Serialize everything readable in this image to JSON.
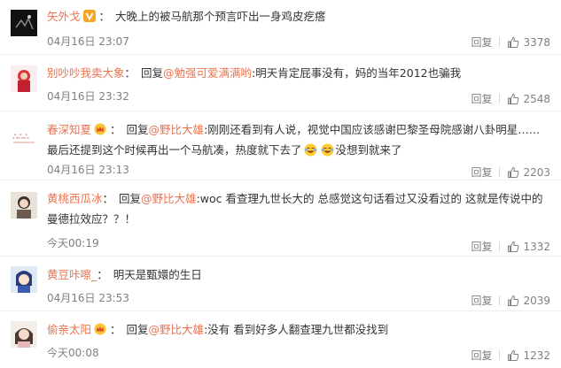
{
  "reply_label": "回复",
  "comments": [
    {
      "user": "矢外戈",
      "badge": "vip-orange",
      "reply_prefix": "",
      "mention": "",
      "text": "大晚上的被马航那个预言吓出一身鸡皮疙瘩",
      "emoji_text": "",
      "time": "04月16日 23:07",
      "likes": "3378"
    },
    {
      "user": "别吵吵我卖大象",
      "badge": "",
      "reply_prefix": "回复",
      "mention": "@勉强可爱满满哟",
      "text": "明天肯定屁事没有，妈的当年2012也骗我",
      "emoji_text": "",
      "time": "04月16日 23:32",
      "likes": "2548"
    },
    {
      "user": "春深知夏",
      "badge": "crown",
      "reply_prefix": "回复",
      "mention": "@野比大雄",
      "text": "刚刚还看到有人说，视觉中国应该感谢巴黎圣母院感谢八卦明星……最后还提到这个时候再出一个马航凑，热度就下去了",
      "emoji_text": "没想到就来了",
      "time": "04月16日 23:13",
      "likes": "2203"
    },
    {
      "user": "黄桃西瓜冰",
      "badge": "",
      "reply_prefix": "回复",
      "mention": "@野比大雄",
      "text": "woc 看查理九世长大的 总感觉这句话看过又没看过的 这就是传说中的曼德拉效应？？！",
      "emoji_text": "",
      "time": "今天00:19",
      "likes": "1332"
    },
    {
      "user": "黄豆咔嚓_",
      "badge": "",
      "reply_prefix": "",
      "mention": "",
      "text": "明天是甄嬛的生日",
      "emoji_text": "",
      "time": "04月16日 23:53",
      "likes": "2039"
    },
    {
      "user": "偷亲太阳",
      "badge": "crown",
      "reply_prefix": "回复",
      "mention": "@野比大雄",
      "text": "没有 看到好多人翻查理九世都没找到",
      "emoji_text": "",
      "time": "今天00:08",
      "likes": "1232"
    }
  ]
}
